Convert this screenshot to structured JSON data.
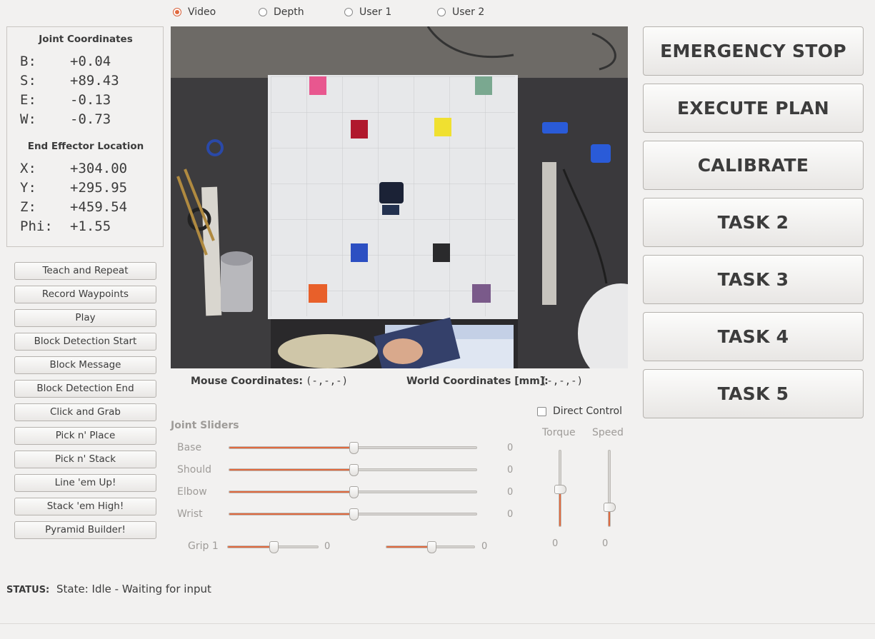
{
  "view_modes": {
    "options": [
      "Video",
      "Depth",
      "User 1",
      "User 2"
    ],
    "selected": "Video"
  },
  "joint_coordinates": {
    "title": "Joint Coordinates",
    "rows": [
      {
        "label": "B:",
        "value": "+0.04"
      },
      {
        "label": "S:",
        "value": "+89.43"
      },
      {
        "label": "E:",
        "value": "-0.13"
      },
      {
        "label": "W:",
        "value": "-0.73"
      }
    ]
  },
  "end_effector": {
    "title": "End Effector Location",
    "rows": [
      {
        "label": "X:",
        "value": "+304.00"
      },
      {
        "label": "Y:",
        "value": "+295.95"
      },
      {
        "label": "Z:",
        "value": "+459.54"
      },
      {
        "label": "Phi:",
        "value": "+1.55"
      }
    ]
  },
  "left_buttons": [
    "Teach and Repeat",
    "Record Waypoints",
    "Play",
    "Block Detection Start",
    "Block Message",
    "Block Detection End",
    "Click and Grab",
    "Pick n' Place",
    "Pick n' Stack",
    "Line 'em Up!",
    "Stack 'em High!",
    "Pyramid Builder!"
  ],
  "coords": {
    "mouse_label": "Mouse Coordinates:",
    "mouse_value": "(-,-,-)",
    "world_label": "World Coordinates [mm]:",
    "world_value": "(-,-,-)"
  },
  "direct_control": {
    "label": "Direct Control",
    "checked": false
  },
  "joint_sliders": {
    "title": "Joint Sliders",
    "sliders": [
      {
        "label": "Base",
        "value": "0",
        "level": 0.5
      },
      {
        "label": "Should",
        "value": "0",
        "level": 0.5
      },
      {
        "label": "Elbow",
        "value": "0",
        "level": 0.5
      },
      {
        "label": "Wrist",
        "value": "0",
        "level": 0.5
      }
    ],
    "grip1": {
      "label": "Grip 1",
      "value": "0",
      "level": 0.5
    },
    "grip2": {
      "value": "0",
      "level": 0.5
    }
  },
  "torque": {
    "label": "Torque",
    "value": "0",
    "level": 0.5
  },
  "speed": {
    "label": "Speed",
    "value": "0",
    "level": 0.27
  },
  "right_buttons": [
    "EMERGENCY STOP",
    "EXECUTE PLAN",
    "CALIBRATE",
    "TASK 2",
    "TASK 3",
    "TASK 4",
    "TASK 5"
  ],
  "status": {
    "label": "STATUS:",
    "text": "State: Idle - Waiting for input"
  },
  "colors": {
    "accent": "#e0693e"
  }
}
